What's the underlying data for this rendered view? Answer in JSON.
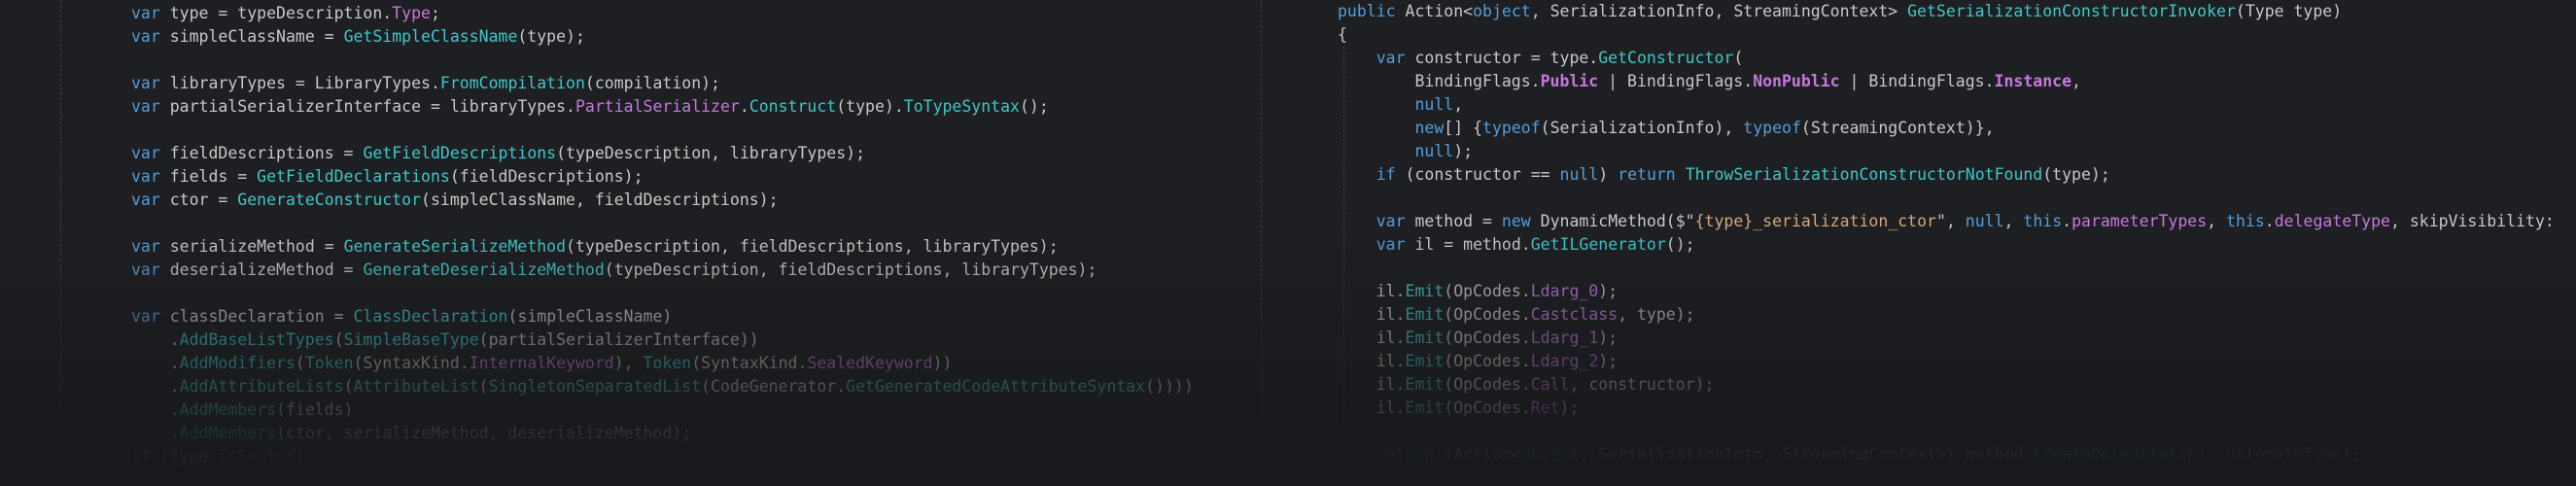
{
  "left_code": [
    [
      {
        "t": "var ",
        "c": "kw"
      },
      {
        "t": "type = typeDescription."
      },
      {
        "t": "Type",
        "c": "prop"
      },
      {
        "t": ";"
      }
    ],
    [
      {
        "t": "var ",
        "c": "kw"
      },
      {
        "t": "simpleClassName = "
      },
      {
        "t": "GetSimpleClassName",
        "c": "fn"
      },
      {
        "t": "(type);"
      }
    ],
    [],
    [
      {
        "t": "var ",
        "c": "kw"
      },
      {
        "t": "libraryTypes = LibraryTypes."
      },
      {
        "t": "FromCompilation",
        "c": "fn"
      },
      {
        "t": "(compilation);"
      }
    ],
    [
      {
        "t": "var ",
        "c": "kw"
      },
      {
        "t": "partialSerializerInterface = libraryTypes."
      },
      {
        "t": "PartialSerializer",
        "c": "prop"
      },
      {
        "t": "."
      },
      {
        "t": "Construct",
        "c": "fn"
      },
      {
        "t": "(type)."
      },
      {
        "t": "ToTypeSyntax",
        "c": "fn"
      },
      {
        "t": "();"
      }
    ],
    [],
    [
      {
        "t": "var ",
        "c": "kw"
      },
      {
        "t": "fieldDescriptions = "
      },
      {
        "t": "GetFieldDescriptions",
        "c": "fn"
      },
      {
        "t": "(typeDescription, libraryTypes);"
      }
    ],
    [
      {
        "t": "var ",
        "c": "kw"
      },
      {
        "t": "fields = "
      },
      {
        "t": "GetFieldDeclarations",
        "c": "fn"
      },
      {
        "t": "(fieldDescriptions);"
      }
    ],
    [
      {
        "t": "var ",
        "c": "kw"
      },
      {
        "t": "ctor = "
      },
      {
        "t": "GenerateConstructor",
        "c": "fn"
      },
      {
        "t": "(simpleClassName, fieldDescriptions);"
      }
    ],
    [],
    [
      {
        "t": "var ",
        "c": "kw"
      },
      {
        "t": "serializeMethod = "
      },
      {
        "t": "GenerateSerializeMethod",
        "c": "fn"
      },
      {
        "t": "(typeDescription, fieldDescriptions, libraryTypes);"
      }
    ],
    [
      {
        "t": "var ",
        "c": "kw"
      },
      {
        "t": "deserializeMethod = "
      },
      {
        "t": "GenerateDeserializeMethod",
        "c": "fn"
      },
      {
        "t": "(typeDescription, fieldDescriptions, libraryTypes);"
      }
    ],
    [],
    [
      {
        "t": "var ",
        "c": "kw"
      },
      {
        "t": "classDeclaration = "
      },
      {
        "t": "ClassDeclaration",
        "c": "fn"
      },
      {
        "t": "(simpleClassName)"
      }
    ],
    [
      {
        "t": "    ."
      },
      {
        "t": "AddBaseListTypes",
        "c": "fn"
      },
      {
        "t": "("
      },
      {
        "t": "SimpleBaseType",
        "c": "fn"
      },
      {
        "t": "(partialSerializerInterface))"
      }
    ],
    [
      {
        "t": "    ."
      },
      {
        "t": "AddModifiers",
        "c": "fn"
      },
      {
        "t": "("
      },
      {
        "t": "Token",
        "c": "fn"
      },
      {
        "t": "(SyntaxKind."
      },
      {
        "t": "InternalKeyword",
        "c": "prop"
      },
      {
        "t": "), "
      },
      {
        "t": "Token",
        "c": "fn"
      },
      {
        "t": "(SyntaxKind."
      },
      {
        "t": "SealedKeyword",
        "c": "prop"
      },
      {
        "t": "))"
      }
    ],
    [
      {
        "t": "    ."
      },
      {
        "t": "AddAttributeLists",
        "c": "fn"
      },
      {
        "t": "("
      },
      {
        "t": "AttributeList",
        "c": "fn"
      },
      {
        "t": "("
      },
      {
        "t": "SingletonSeparatedList",
        "c": "fn"
      },
      {
        "t": "(CodeGenerator."
      },
      {
        "t": "GetGeneratedCodeAttributeSyntax",
        "c": "fn"
      },
      {
        "t": "())))"
      }
    ],
    [
      {
        "t": "    ."
      },
      {
        "t": "AddMembers",
        "c": "fn"
      },
      {
        "t": "(fields)"
      }
    ],
    [
      {
        "t": "    ."
      },
      {
        "t": "AddMembers",
        "c": "fn"
      },
      {
        "t": "(ctor, serializeMethod, deserializeMethod);"
      }
    ],
    [
      {
        "t": "if ",
        "c": "kw"
      },
      {
        "t": "(type."
      },
      {
        "t": "IsSealed",
        "c": "prop"
      },
      {
        "t": ")"
      }
    ]
  ],
  "right_code": [
    [
      {
        "t": "public ",
        "c": "kw"
      },
      {
        "t": "Action<"
      },
      {
        "t": "object",
        "c": "kw"
      },
      {
        "t": ", SerializationInfo, StreamingContext> "
      },
      {
        "t": "GetSerializationConstructorInvoker",
        "c": "fn"
      },
      {
        "t": "(Type type)"
      }
    ],
    [
      {
        "t": "{"
      }
    ],
    [
      {
        "t": "    "
      },
      {
        "t": "var ",
        "c": "kw"
      },
      {
        "t": "constructor = type."
      },
      {
        "t": "GetConstructor",
        "c": "fn"
      },
      {
        "t": "("
      }
    ],
    [
      {
        "t": "        BindingFlags."
      },
      {
        "t": "Public",
        "c": "bold"
      },
      {
        "t": " | BindingFlags."
      },
      {
        "t": "NonPublic",
        "c": "bold"
      },
      {
        "t": " | BindingFlags."
      },
      {
        "t": "Instance",
        "c": "bold"
      },
      {
        "t": ","
      }
    ],
    [
      {
        "t": "        "
      },
      {
        "t": "null",
        "c": "kw"
      },
      {
        "t": ","
      }
    ],
    [
      {
        "t": "        "
      },
      {
        "t": "new",
        "c": "kw"
      },
      {
        "t": "[] {"
      },
      {
        "t": "typeof",
        "c": "kw"
      },
      {
        "t": "(SerializationInfo), "
      },
      {
        "t": "typeof",
        "c": "kw"
      },
      {
        "t": "(StreamingContext)},"
      }
    ],
    [
      {
        "t": "        "
      },
      {
        "t": "null",
        "c": "kw"
      },
      {
        "t": ");"
      }
    ],
    [
      {
        "t": "    "
      },
      {
        "t": "if ",
        "c": "kw"
      },
      {
        "t": "(constructor == "
      },
      {
        "t": "null",
        "c": "kw"
      },
      {
        "t": ") "
      },
      {
        "t": "return ",
        "c": "kw"
      },
      {
        "t": "ThrowSerializationConstructorNotFound",
        "c": "fn"
      },
      {
        "t": "(type);"
      }
    ],
    [],
    [
      {
        "t": "    "
      },
      {
        "t": "var ",
        "c": "kw"
      },
      {
        "t": "method = "
      },
      {
        "t": "new ",
        "c": "kw"
      },
      {
        "t": "DynamicMethod($\""
      },
      {
        "t": "{type}_serialization_ctor",
        "c": "str"
      },
      {
        "t": "\", "
      },
      {
        "t": "null",
        "c": "kw"
      },
      {
        "t": ", "
      },
      {
        "t": "this",
        "c": "kw"
      },
      {
        "t": "."
      },
      {
        "t": "parameterTypes",
        "c": "prop"
      },
      {
        "t": ", "
      },
      {
        "t": "this",
        "c": "kw"
      },
      {
        "t": "."
      },
      {
        "t": "delegateType",
        "c": "prop"
      },
      {
        "t": ", skipVisibility:"
      }
    ],
    [
      {
        "t": "    "
      },
      {
        "t": "var ",
        "c": "kw"
      },
      {
        "t": "il = method."
      },
      {
        "t": "GetILGenerator",
        "c": "fn"
      },
      {
        "t": "();"
      }
    ],
    [],
    [
      {
        "t": "    il."
      },
      {
        "t": "Emit",
        "c": "fn"
      },
      {
        "t": "(OpCodes."
      },
      {
        "t": "Ldarg_0",
        "c": "prop"
      },
      {
        "t": ");"
      }
    ],
    [
      {
        "t": "    il."
      },
      {
        "t": "Emit",
        "c": "fn"
      },
      {
        "t": "(OpCodes."
      },
      {
        "t": "Castclass",
        "c": "prop"
      },
      {
        "t": ", type);"
      }
    ],
    [
      {
        "t": "    il."
      },
      {
        "t": "Emit",
        "c": "fn"
      },
      {
        "t": "(OpCodes."
      },
      {
        "t": "Ldarg_1",
        "c": "prop"
      },
      {
        "t": ");"
      }
    ],
    [
      {
        "t": "    il."
      },
      {
        "t": "Emit",
        "c": "fn"
      },
      {
        "t": "(OpCodes."
      },
      {
        "t": "Ldarg_2",
        "c": "prop"
      },
      {
        "t": ");"
      }
    ],
    [
      {
        "t": "    il."
      },
      {
        "t": "Emit",
        "c": "fn"
      },
      {
        "t": "(OpCodes."
      },
      {
        "t": "Call",
        "c": "prop"
      },
      {
        "t": ", constructor);"
      }
    ],
    [
      {
        "t": "    il."
      },
      {
        "t": "Emit",
        "c": "fn"
      },
      {
        "t": "(OpCodes."
      },
      {
        "t": "Ret",
        "c": "prop"
      },
      {
        "t": ");"
      }
    ],
    [],
    [
      {
        "t": "    "
      },
      {
        "t": "return ",
        "c": "kw"
      },
      {
        "t": "(Action<"
      },
      {
        "t": "object",
        "c": "kw"
      },
      {
        "t": ", SerializationInfo, StreamingContext>) method."
      },
      {
        "t": "CreateDelegate",
        "c": "fn"
      },
      {
        "t": "("
      },
      {
        "t": "this",
        "c": "kw"
      },
      {
        "t": "."
      },
      {
        "t": "delegateType",
        "c": "prop"
      },
      {
        "t": ");"
      }
    ]
  ]
}
